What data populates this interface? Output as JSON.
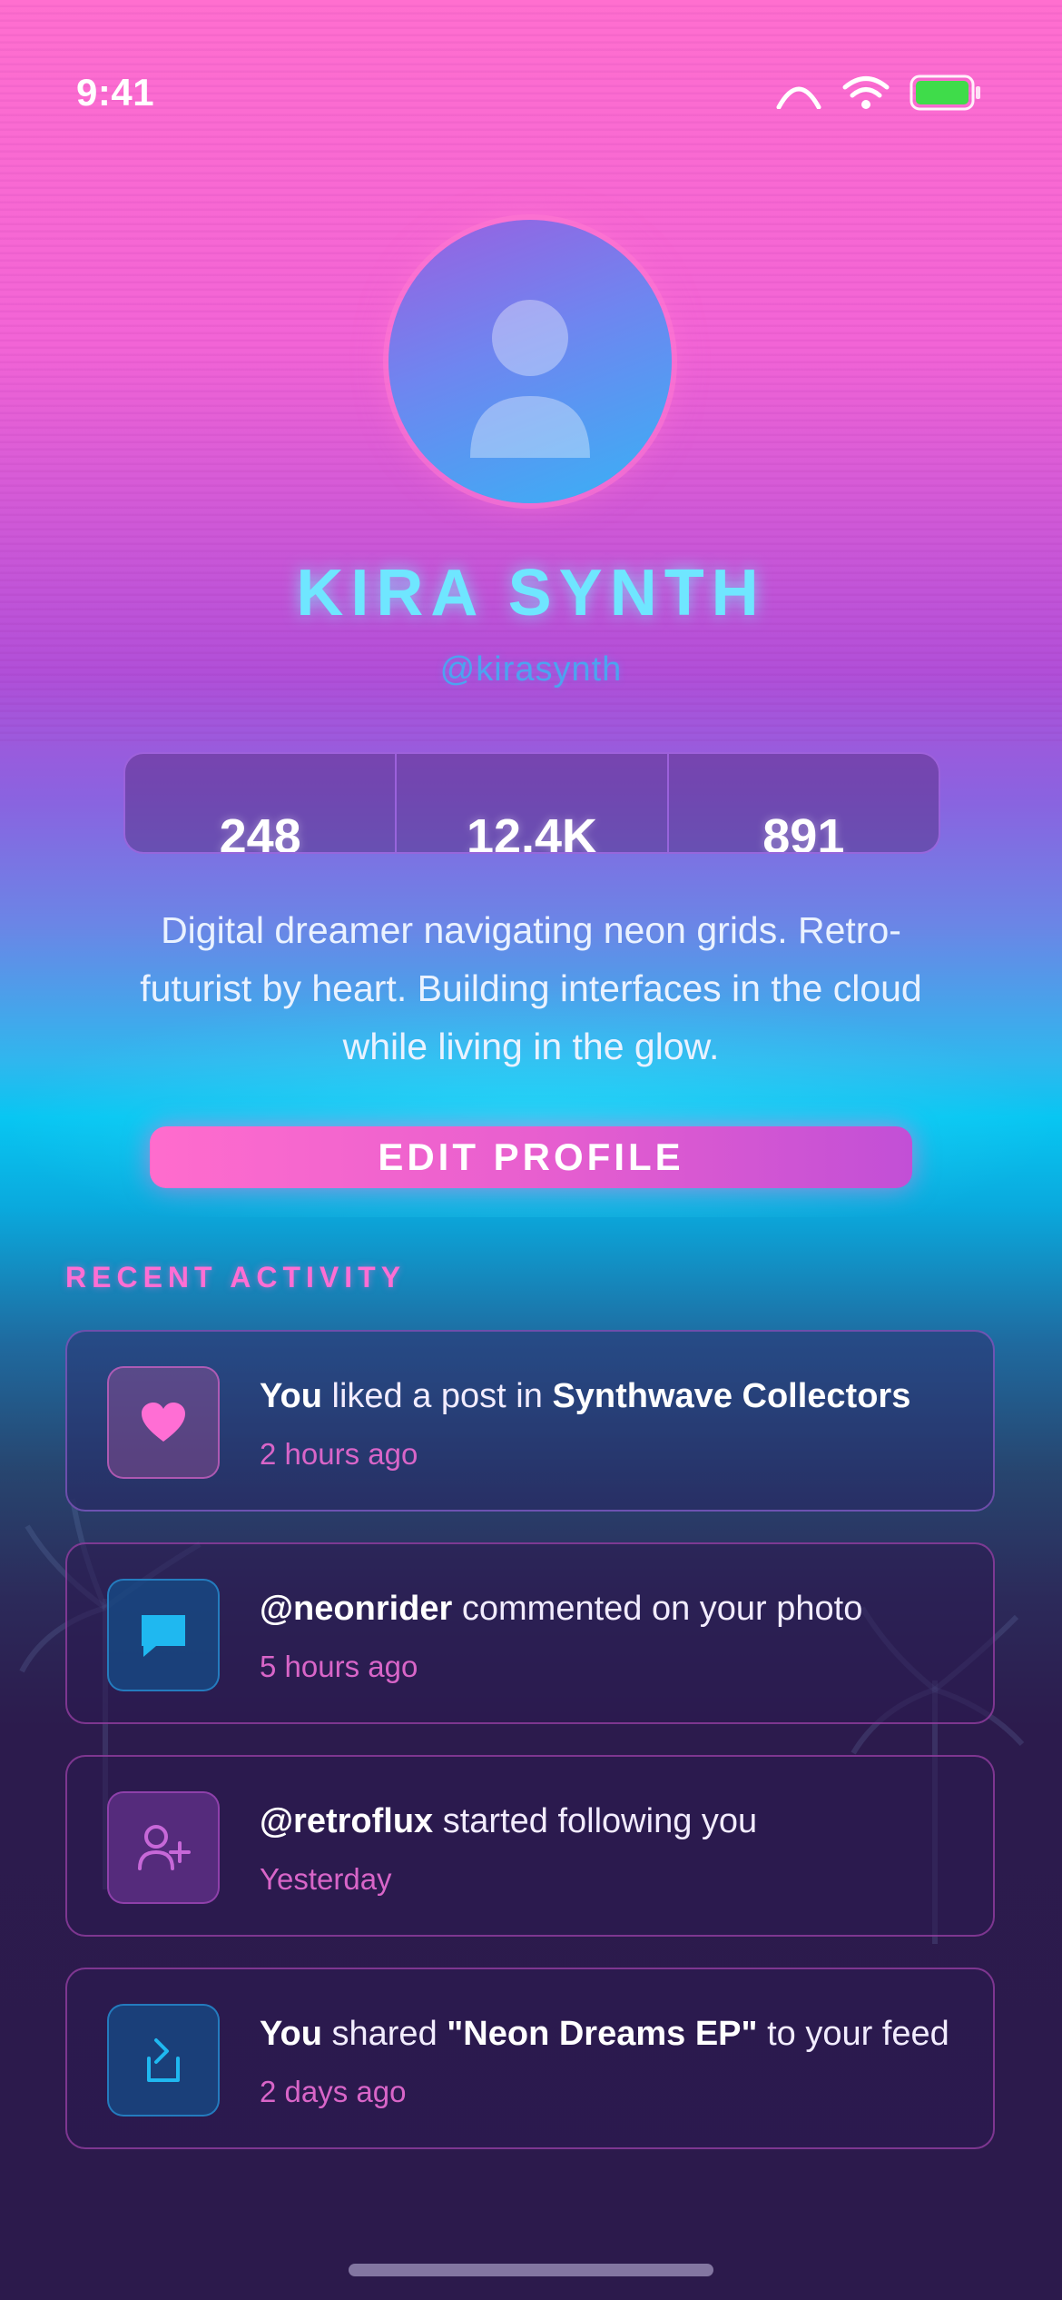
{
  "status_bar": {
    "time": "9:41"
  },
  "profile": {
    "name": "KIRA SYNTH",
    "handle": "@kirasynth",
    "stats": [
      {
        "value": "248"
      },
      {
        "value": "12.4K"
      },
      {
        "value": "891"
      }
    ],
    "bio": "Digital dreamer navigating neon grids. Retro-futurist by heart. Building interfaces in the cloud while living in the glow."
  },
  "edit_button": {
    "label": "EDIT PROFILE"
  },
  "recent_activity": {
    "title": "RECENT ACTIVITY",
    "items": [
      {
        "icon": "heart-icon",
        "actor": "You",
        "text": " liked a post in ",
        "target": "Synthwave Collectors",
        "suffix": "",
        "time": "2 hours ago"
      },
      {
        "icon": "comment-icon",
        "actor": "@neonrider",
        "text": " commented on your photo",
        "target": "",
        "suffix": "",
        "time": "5 hours ago"
      },
      {
        "icon": "user-plus-icon",
        "actor": "@retroflux",
        "text": " started following you",
        "target": "",
        "suffix": "",
        "time": "Yesterday"
      },
      {
        "icon": "share-icon",
        "actor": "You",
        "text": " shared ",
        "target": "\"Neon Dreams EP\"",
        "suffix": " to your feed",
        "time": "2 days ago"
      }
    ]
  },
  "colors": {
    "accent_pink": "#ff6ed4",
    "accent_cyan": "#6fe6ff",
    "battery_green": "#3fdc4a"
  }
}
